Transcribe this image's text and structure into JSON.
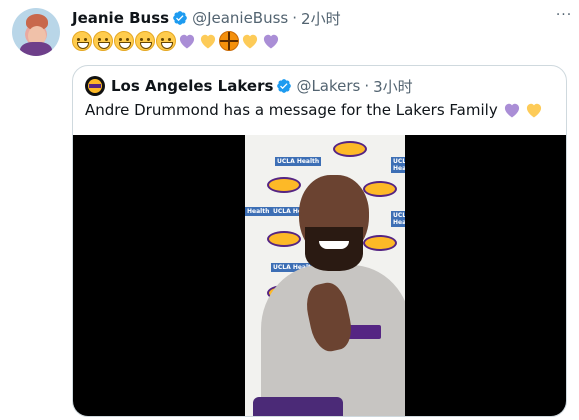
{
  "author": {
    "name": "Jeanie Buss",
    "handle": "@JeanieBuss",
    "separator": "·",
    "time": "2小时",
    "verified": true
  },
  "more_menu": {
    "label": "···"
  },
  "emoji_sequence": [
    "grinning-face",
    "grinning-face",
    "grinning-face",
    "grinning-face",
    "grinning-face",
    "purple-heart",
    "yellow-heart",
    "basketball",
    "yellow-heart",
    "purple-heart"
  ],
  "colors": {
    "text_primary": "#0f1419",
    "text_secondary": "#536471",
    "border": "#cfd9de",
    "verified_blue": "#1d9bf0",
    "purple_heart": "#aa8ed6",
    "yellow_heart": "#fdcb58",
    "lakers_purple": "#552583",
    "lakers_gold": "#fdb927"
  },
  "quoted_tweet": {
    "name": "Los Angeles Lakers",
    "handle": "@Lakers",
    "separator": "·",
    "time": "3小时",
    "verified": true,
    "text": "Andre Drummond has a message for the Lakers Family",
    "text_emojis": [
      "purple-heart",
      "yellow-heart"
    ]
  },
  "media": {
    "type": "video",
    "backdrop_labels": [
      "UCLA Health",
      "UCLA Health",
      "UCLA Health",
      "Health",
      "UCLA Health",
      "UCLA Health"
    ]
  }
}
